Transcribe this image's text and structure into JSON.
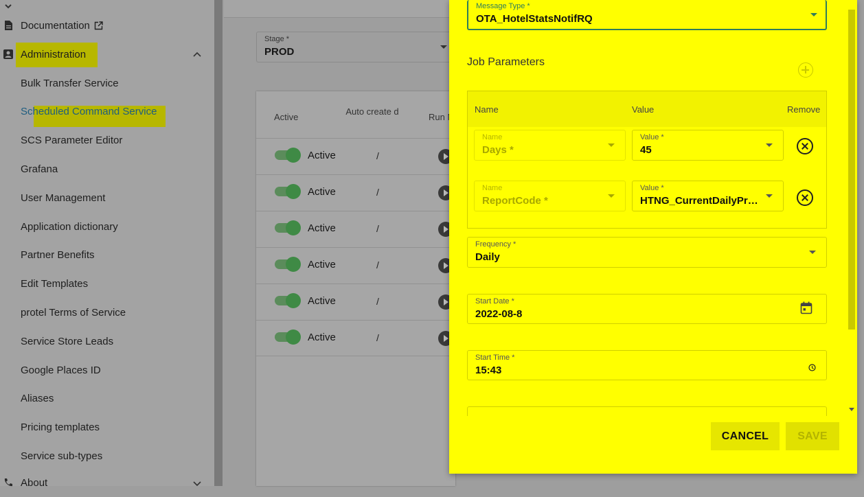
{
  "sidebar": {
    "documentation": "Documentation",
    "administration": "Administration",
    "items": [
      {
        "label": "Bulk Transfer Service"
      },
      {
        "label": "Scheduled Command Service"
      },
      {
        "label": "SCS Parameter Editor"
      },
      {
        "label": "Grafana"
      },
      {
        "label": "User Management"
      },
      {
        "label": "Application dictionary"
      },
      {
        "label": "Partner Benefits"
      },
      {
        "label": "Edit Templates"
      },
      {
        "label": "protel Terms of Service"
      },
      {
        "label": "Service Store Leads"
      },
      {
        "label": "Google Places ID"
      },
      {
        "label": "Aliases"
      },
      {
        "label": "Pricing templates"
      },
      {
        "label": "Service sub-types"
      }
    ],
    "about": "About"
  },
  "stage": {
    "label": "Stage *",
    "value": "PROD"
  },
  "table": {
    "headers": {
      "active": "Active",
      "auto_created": "Auto create d",
      "run": "Run N"
    },
    "rows": [
      {
        "status": "Active",
        "auto": "/"
      },
      {
        "status": "Active",
        "auto": "/"
      },
      {
        "status": "Active",
        "auto": "/"
      },
      {
        "status": "Active",
        "auto": "/"
      },
      {
        "status": "Active",
        "auto": "/"
      },
      {
        "status": "Active",
        "auto": "/"
      }
    ]
  },
  "dialog": {
    "message_type": {
      "label": "Message Type *",
      "value": "OTA_HotelStatsNotifRQ"
    },
    "job_parameters": {
      "title": "Job Parameters",
      "headers": {
        "name": "Name",
        "value": "Value",
        "remove": "Remove"
      },
      "rows": [
        {
          "name_label": "Name",
          "name_value": "Days *",
          "value_label": "Value *",
          "value_value": "45"
        },
        {
          "name_label": "Name",
          "name_value": "ReportCode *",
          "value_label": "Value *",
          "value_value": "HTNG_CurrentDailyProp…"
        }
      ]
    },
    "frequency": {
      "label": "Frequency *",
      "value": "Daily"
    },
    "start_date": {
      "label": "Start Date *",
      "value": "2022-08-8"
    },
    "start_time": {
      "label": "Start Time *",
      "value": "15:43"
    },
    "cancel": "CANCEL",
    "save": "SAVE"
  },
  "colors": {
    "dialog_bg": "#ffff00",
    "highlight": "#b7b700",
    "toggle_on": "#3f8a45"
  }
}
